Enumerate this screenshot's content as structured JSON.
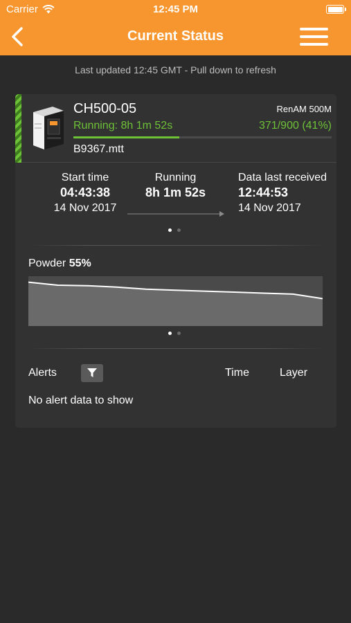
{
  "status_bar": {
    "carrier": "Carrier",
    "time": "12:45 PM"
  },
  "nav": {
    "title": "Current Status"
  },
  "last_updated": "Last updated 12:45 GMT - Pull down to refresh",
  "machine": {
    "name": "CH500-05",
    "model": "RenAM 500M",
    "running_text": "Running: 8h 1m 52s",
    "layers": "371/900 (41%)",
    "progress_fraction": 0.41,
    "file": "B9367.mtt",
    "status_color": "#6ec238"
  },
  "stats": {
    "start_label": "Start time",
    "start_time": "04:43:38",
    "start_date": "14 Nov 2017",
    "running_label": "Running",
    "running_value": "8h 1m 52s",
    "received_label": "Data last received",
    "received_time": "12:44:53",
    "received_date": "14 Nov 2017",
    "page_index": 0,
    "page_count": 2
  },
  "powder": {
    "label": "Powder",
    "value": "55%",
    "page_index": 0,
    "page_count": 2,
    "chart_data": {
      "type": "area",
      "x": [
        0,
        1,
        2,
        3,
        4,
        5,
        6,
        7,
        8,
        9,
        10
      ],
      "values": [
        88,
        82,
        81,
        78,
        74,
        72,
        70,
        68,
        66,
        64,
        55
      ],
      "ylim": [
        0,
        100
      ]
    }
  },
  "alerts": {
    "label": "Alerts",
    "time_header": "Time",
    "layer_header": "Layer",
    "empty_text": "No alert data to show"
  },
  "colors": {
    "accent": "#f7962e",
    "background": "#2a2a2a",
    "card": "#323232",
    "running": "#6ec238"
  }
}
